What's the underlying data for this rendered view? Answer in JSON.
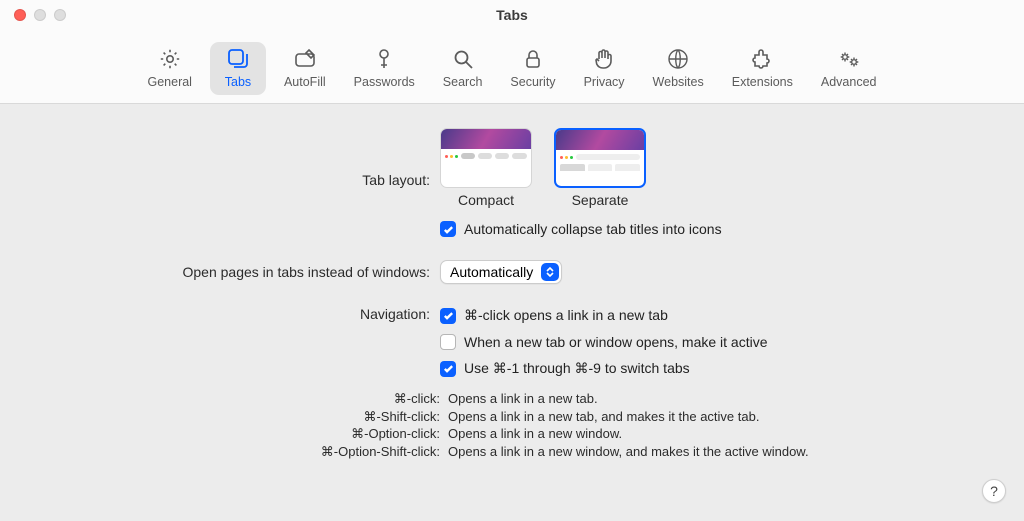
{
  "window": {
    "title": "Tabs"
  },
  "toolbar": {
    "tabs": [
      {
        "label": "General",
        "icon": "gear"
      },
      {
        "label": "Tabs",
        "icon": "tabs",
        "active": true
      },
      {
        "label": "AutoFill",
        "icon": "pencil-box"
      },
      {
        "label": "Passwords",
        "icon": "key"
      },
      {
        "label": "Search",
        "icon": "search"
      },
      {
        "label": "Security",
        "icon": "lock"
      },
      {
        "label": "Privacy",
        "icon": "hand"
      },
      {
        "label": "Websites",
        "icon": "globe"
      },
      {
        "label": "Extensions",
        "icon": "puzzle"
      },
      {
        "label": "Advanced",
        "icon": "gears"
      }
    ]
  },
  "labels": {
    "tab_layout": "Tab layout:",
    "open_pages": "Open pages in tabs instead of windows:",
    "navigation": "Navigation:"
  },
  "layout_options": {
    "compact": "Compact",
    "separate": "Separate",
    "selected": "separate"
  },
  "checkboxes": {
    "collapse_titles": {
      "label": "Automatically collapse tab titles into icons",
      "checked": true
    },
    "cmd_click": {
      "label": "⌘-click opens a link in a new tab",
      "checked": true
    },
    "make_active": {
      "label": "When a new tab or window opens, make it active",
      "checked": false
    },
    "cmd_numbers": {
      "label": "Use ⌘-1 through ⌘-9 to switch tabs",
      "checked": true
    }
  },
  "open_pages_popup": {
    "value": "Automatically"
  },
  "shortcuts": [
    {
      "key": "⌘-click:",
      "desc": "Opens a link in a new tab."
    },
    {
      "key": "⌘-Shift-click:",
      "desc": "Opens a link in a new tab, and makes it the active tab."
    },
    {
      "key": "⌘-Option-click:",
      "desc": "Opens a link in a new window."
    },
    {
      "key": "⌘-Option-Shift-click:",
      "desc": "Opens a link in a new window, and makes it the active window."
    }
  ],
  "help_button": "?"
}
